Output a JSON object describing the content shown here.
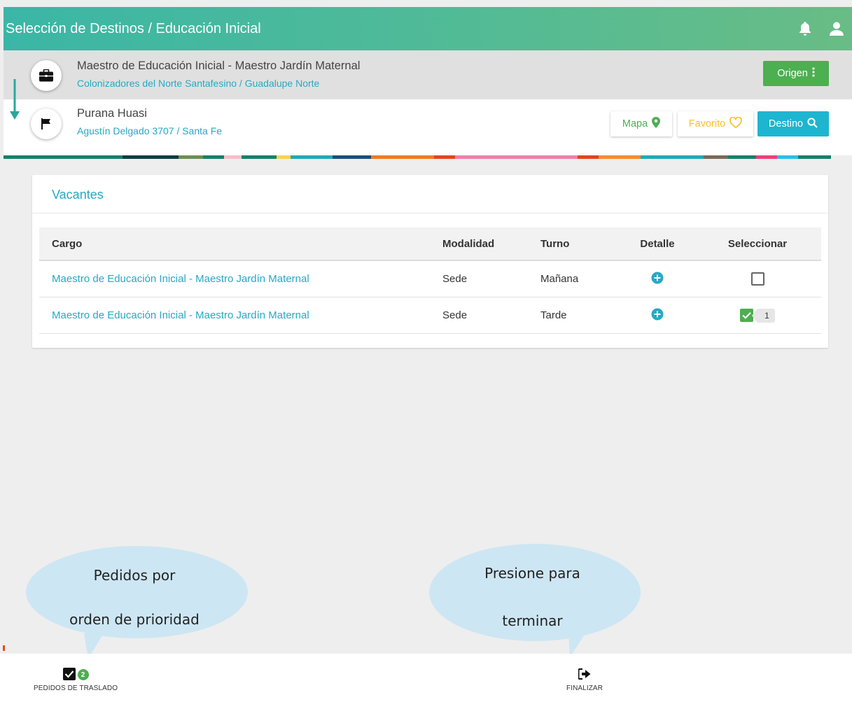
{
  "header": {
    "title": "Selección de Destinos / Educación Inicial",
    "icons": [
      "bell-icon",
      "user-icon"
    ]
  },
  "origin": {
    "title": "Maestro de Educación Inicial - Maestro Jardín Maternal",
    "subtitle": "Colonizadores del Norte Santafesino / Guadalupe Norte",
    "icon": "briefcase-icon",
    "button_label": "Origen"
  },
  "destination": {
    "title": "Purana Huasi",
    "subtitle": "Agustín Delgado 3707 / Santa Fe",
    "icon": "flag-icon",
    "map_label": "Mapa",
    "favorite_label": "Favorito",
    "destino_label": "Destino"
  },
  "colors": {
    "accent": "#26a9c5",
    "green": "#4caf50",
    "yellow": "#fbc02d",
    "cyan": "#1eb5d1"
  },
  "vacantes": {
    "title": "Vacantes",
    "columns": [
      "Cargo",
      "Modalidad",
      "Turno",
      "Detalle",
      "Seleccionar"
    ],
    "rows": [
      {
        "cargo": "Maestro de Educación Inicial - Maestro Jardín Maternal",
        "modalidad": "Sede",
        "turno": "Mañana",
        "selected": false,
        "order": ""
      },
      {
        "cargo": "Maestro de Educación Inicial - Maestro Jardín Maternal",
        "modalidad": "Sede",
        "turno": "Tarde",
        "selected": true,
        "order": "1"
      }
    ]
  },
  "bottom": {
    "pedidos_label": "PEDIDOS DE TRASLADO",
    "pedidos_count": "2",
    "finalizar_label": "FINALIZAR"
  },
  "tooltips": {
    "left": {
      "line1": "Pedidos por",
      "line2": "orden de prioridad"
    },
    "right": {
      "line1": "Presione para",
      "line2": "terminar"
    }
  }
}
